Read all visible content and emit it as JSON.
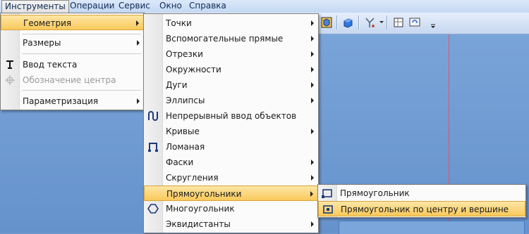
{
  "menubar": {
    "items": [
      "Инструменты",
      "Операции",
      "Сервис",
      "Окно",
      "Справка"
    ]
  },
  "menu_tools": {
    "items": [
      {
        "label": "Геометрия",
        "submenu": true,
        "highlighted": true
      },
      {
        "label": "Размеры",
        "submenu": true
      },
      {
        "label": "Ввод текста",
        "icon": "text-input-icon"
      },
      {
        "label": "Обозначение центра",
        "icon": "center-mark-icon",
        "disabled": true
      },
      {
        "label": "Параметризация",
        "submenu": true
      }
    ]
  },
  "menu_geometry": {
    "items": [
      {
        "label": "Точки",
        "submenu": true
      },
      {
        "label": "Вспомогательные прямые",
        "submenu": true
      },
      {
        "label": "Отрезки",
        "submenu": true
      },
      {
        "label": "Окружности",
        "submenu": true
      },
      {
        "label": "Дуги",
        "submenu": true
      },
      {
        "label": "Эллипсы",
        "submenu": true
      },
      {
        "label": "Непрерывный ввод объектов",
        "icon": "continuous-input-icon"
      },
      {
        "label": "Кривые",
        "submenu": true
      },
      {
        "label": "Ломаная",
        "icon": "polyline-icon"
      },
      {
        "label": "Фаски",
        "submenu": true
      },
      {
        "label": "Скругления",
        "submenu": true
      },
      {
        "label": "Прямоугольники",
        "submenu": true,
        "highlighted": true
      },
      {
        "label": "Многоугольник",
        "icon": "polygon-icon"
      },
      {
        "label": "Эквидистанты",
        "submenu": true
      }
    ]
  },
  "menu_rectangles": {
    "items": [
      {
        "label": "Прямоугольник",
        "icon": "rectangle-icon"
      },
      {
        "label": "Прямоугольник по центру и вершине",
        "icon": "rectangle-center-icon",
        "highlighted": true
      }
    ]
  },
  "colors": {
    "highlight": "#f9c95b",
    "workspace": "#6d98cf",
    "menu_bg": "#fbfbfb"
  }
}
